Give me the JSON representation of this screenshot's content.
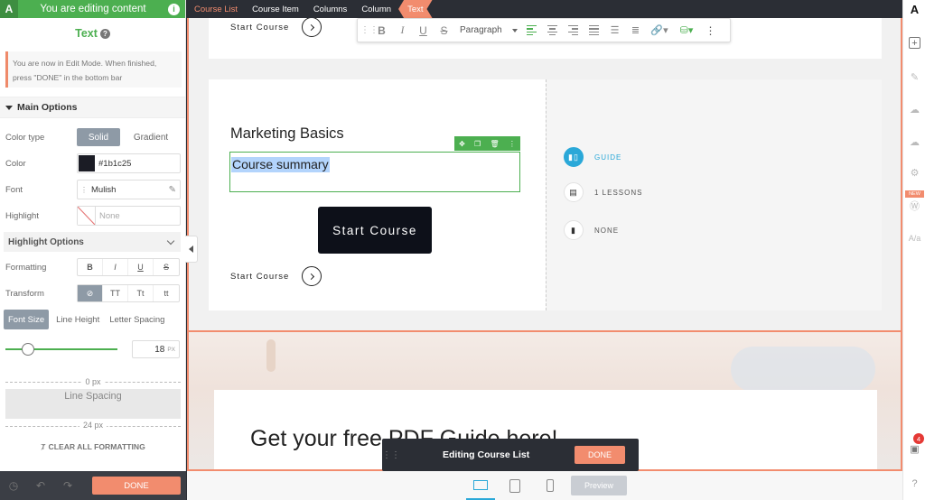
{
  "left": {
    "header": "You are editing content",
    "panel_title": "Text",
    "notice": "You are now in Edit Mode. When finished, press \"DONE\" in the bottom bar",
    "main_options": "Main Options",
    "color_type": {
      "label": "Color type",
      "options": [
        "Solid",
        "Gradient"
      ],
      "selected": "Solid"
    },
    "color": {
      "label": "Color",
      "value": "#1b1c25",
      "swatch": "#1b1c25"
    },
    "font": {
      "label": "Font",
      "value": "Mulish"
    },
    "highlight": {
      "label": "Highlight",
      "value": "None"
    },
    "highlight_options": "Highlight Options",
    "formatting": {
      "label": "Formatting",
      "buttons": [
        "B",
        "I",
        "U",
        "S"
      ]
    },
    "transform": {
      "label": "Transform",
      "buttons": [
        "⊘",
        "TT",
        "Tt",
        "tt"
      ]
    },
    "text_tabs": [
      "Font Size",
      "Line Height",
      "Letter Spacing"
    ],
    "font_size": {
      "value": "18",
      "unit": "PX",
      "fraction": 0.2
    },
    "spacing_top": "0 px",
    "line_spacing": "Line Spacing",
    "spacing_bottom": "24 px",
    "clear": "CLEAR ALL FORMATTING",
    "done": "DONE"
  },
  "crumbs": [
    "Course List",
    "Course Item",
    "Columns",
    "Column",
    "Text"
  ],
  "toolbar": {
    "paragraph": "Paragraph"
  },
  "canvas": {
    "top_link": "Start Course",
    "course_title": "Marketing Basics",
    "summary": "Course summary",
    "start_button": "Start Course",
    "bottom_link": "Start Course",
    "meta": [
      {
        "icon": "guide-icon",
        "text": "GUIDE"
      },
      {
        "icon": "document-icon",
        "text": "1 LESSONS"
      },
      {
        "icon": "bar-chart-icon",
        "text": "NONE"
      }
    ],
    "hero_heading": "Get your free PDF Guide here!"
  },
  "editbar": {
    "label": "Editing Course List",
    "done": "DONE"
  },
  "bottom": {
    "preview": "Preview"
  },
  "right": {
    "logo": "A",
    "new_badge": "NEW",
    "notification_count": "4"
  },
  "colors": {
    "accent_green": "#4caf50",
    "accent_orange": "#f28c6e",
    "accent_blue": "#2aa8d8",
    "dark": "#2b2e35"
  }
}
